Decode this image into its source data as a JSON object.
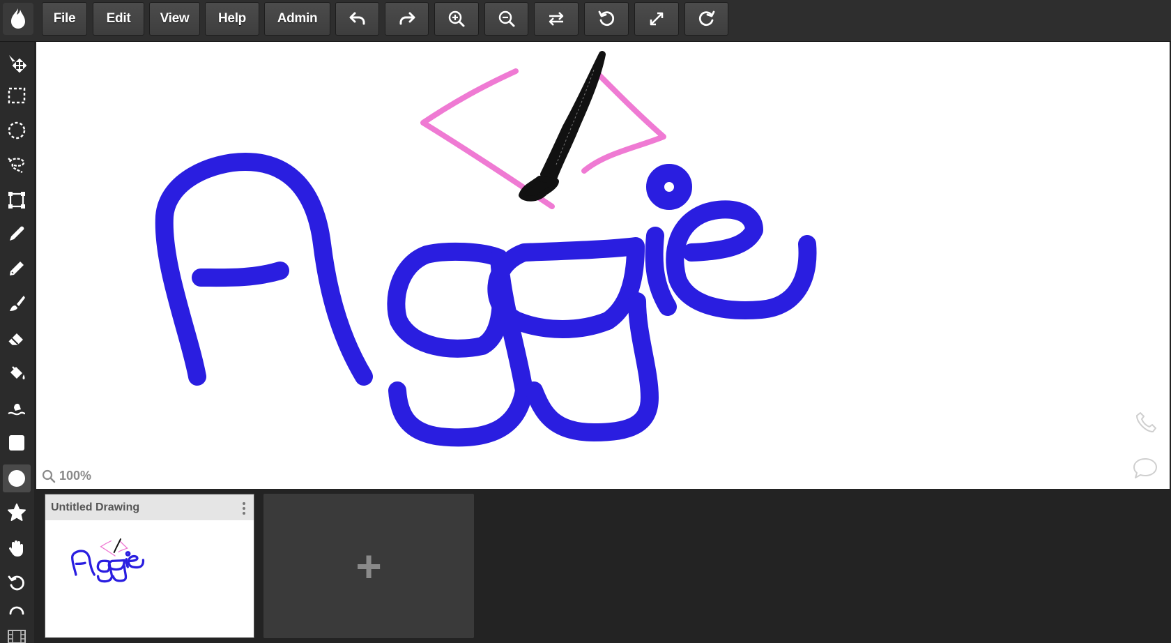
{
  "toolbar": {
    "file_label": "File",
    "edit_label": "Edit",
    "view_label": "View",
    "help_label": "Help",
    "admin_label": "Admin",
    "icons": [
      "undo-icon",
      "redo-icon",
      "zoom-in-icon",
      "zoom-out-icon",
      "flip-icon",
      "rotate-left-icon",
      "fullscreen-icon",
      "rotate-right-icon"
    ]
  },
  "tools": [
    "move",
    "rect-select",
    "ellipse-select",
    "lasso-select",
    "transform",
    "eyedropper",
    "pencil",
    "brush",
    "eraser",
    "fill",
    "smudge",
    "rectangle",
    "ellipse",
    "star",
    "hand",
    "undo",
    "partial"
  ],
  "active_tool": "ellipse",
  "canvas": {
    "zoom_label": "100%",
    "drawing_colors": {
      "text": "#2a1ee0",
      "arrows": "#ef7ad3",
      "brush": "#111111"
    }
  },
  "pages": [
    {
      "title": "Untitled Drawing"
    }
  ],
  "add_page_label": "+"
}
